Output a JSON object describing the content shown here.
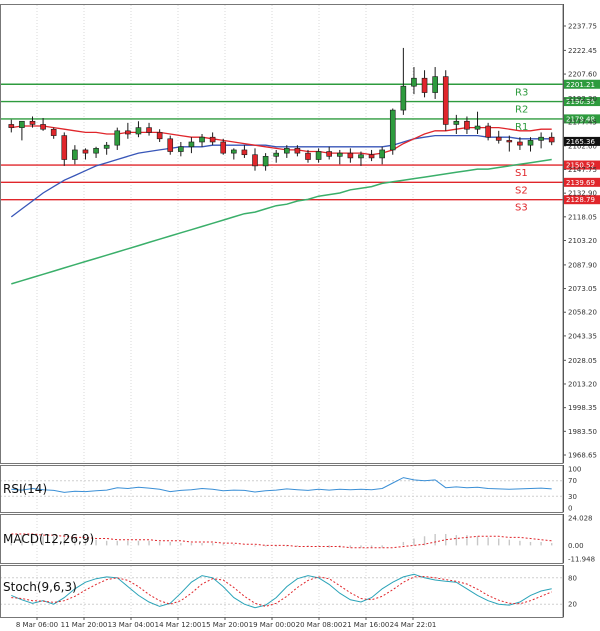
{
  "chart_data": [
    {
      "type": "candlestick",
      "panel": "price",
      "y_ticks": [
        "2237.75",
        "2222.45",
        "2207.60",
        "2192.30",
        "2177.45",
        "2162.60",
        "2147.75",
        "2132.90",
        "2118.05",
        "2103.20",
        "2087.90",
        "2073.05",
        "2058.20",
        "2043.35",
        "2028.05",
        "2013.20",
        "1998.35",
        "1983.50",
        "1968.65"
      ],
      "ylim": [
        1968.65,
        2237.75
      ],
      "x_labels": [
        "8 Mar 06:00",
        "11 Mar 20:00",
        "13 Mar 04:00",
        "14 Mar 12:00",
        "15 Mar 20:00",
        "19 Mar 00:00",
        "20 Mar 08:00",
        "21 Mar 16:00",
        "24 Mar 22:01"
      ],
      "current_price": "2165.36",
      "current_price_value": 2165.36,
      "levels": [
        {
          "label": "R3",
          "value": 2201.21,
          "display": "2201.21",
          "color": "#2e9b3e"
        },
        {
          "label": "R2",
          "value": 2190.35,
          "display": "2190.35",
          "color": "#2e9b3e"
        },
        {
          "label": "R1",
          "value": 2179.48,
          "display": "2179.48",
          "color": "#2e9b3e"
        },
        {
          "label": "S1",
          "value": 2150.52,
          "display": "2150.52",
          "color": "#e0262b"
        },
        {
          "label": "S2",
          "value": 2139.69,
          "display": "2139.69",
          "color": "#e0262b"
        },
        {
          "label": "S3",
          "value": 2128.79,
          "display": "2128.79",
          "color": "#e0262b"
        }
      ],
      "candles": [
        [
          2176,
          2179,
          2171,
          2174
        ],
        [
          2174,
          2176,
          2166,
          2178
        ],
        [
          2178,
          2181,
          2174,
          2176
        ],
        [
          2176,
          2180,
          2172,
          2173
        ],
        [
          2173,
          2174,
          2167,
          2169
        ],
        [
          2169,
          2171,
          2150,
          2154
        ],
        [
          2154,
          2163,
          2151,
          2160
        ],
        [
          2160,
          2161,
          2154,
          2158
        ],
        [
          2158,
          2162,
          2155,
          2161
        ],
        [
          2161,
          2165,
          2157,
          2163
        ],
        [
          2163,
          2174,
          2160,
          2172
        ],
        [
          2172,
          2177,
          2167,
          2170
        ],
        [
          2170,
          2178,
          2168,
          2174
        ],
        [
          2174,
          2177,
          2169,
          2171
        ],
        [
          2171,
          2173,
          2165,
          2167
        ],
        [
          2167,
          2169,
          2157,
          2159
        ],
        [
          2159,
          2165,
          2156,
          2162
        ],
        [
          2162,
          2168,
          2158,
          2165
        ],
        [
          2165,
          2170,
          2162,
          2168
        ],
        [
          2168,
          2171,
          2163,
          2165
        ],
        [
          2165,
          2167,
          2157,
          2158
        ],
        [
          2158,
          2161,
          2154,
          2160
        ],
        [
          2160,
          2163,
          2155,
          2157
        ],
        [
          2157,
          2161,
          2147,
          2150
        ],
        [
          2150,
          2158,
          2147,
          2156
        ],
        [
          2156,
          2160,
          2152,
          2158
        ],
        [
          2158,
          2163,
          2155,
          2161
        ],
        [
          2161,
          2163,
          2156,
          2158
        ],
        [
          2158,
          2160,
          2152,
          2154
        ],
        [
          2154,
          2161,
          2152,
          2159
        ],
        [
          2159,
          2162,
          2154,
          2156
        ],
        [
          2156,
          2160,
          2151,
          2158
        ],
        [
          2158,
          2161,
          2152,
          2155
        ],
        [
          2155,
          2159,
          2150,
          2157
        ],
        [
          2157,
          2160,
          2153,
          2155
        ],
        [
          2155,
          2162,
          2151,
          2160
        ],
        [
          2160,
          2186,
          2157,
          2185
        ],
        [
          2185,
          2224,
          2182,
          2200
        ],
        [
          2200,
          2212,
          2195,
          2205
        ],
        [
          2205,
          2210,
          2193,
          2196
        ],
        [
          2196,
          2212,
          2192,
          2206
        ],
        [
          2206,
          2210,
          2172,
          2176
        ],
        [
          2176,
          2182,
          2170,
          2178
        ],
        [
          2178,
          2181,
          2170,
          2173
        ],
        [
          2173,
          2184,
          2170,
          2175
        ],
        [
          2175,
          2177,
          2166,
          2168
        ],
        [
          2168,
          2172,
          2164,
          2166
        ],
        [
          2166,
          2169,
          2159,
          2165
        ],
        [
          2165,
          2168,
          2160,
          2163
        ],
        [
          2163,
          2168,
          2159,
          2166
        ],
        [
          2166,
          2171,
          2161,
          2168
        ],
        [
          2168,
          2171,
          2163,
          2165
        ]
      ],
      "ma_fast": [
        2174,
        2175,
        2175,
        2175,
        2174,
        2173,
        2172,
        2171,
        2171,
        2170,
        2170,
        2171,
        2171,
        2171,
        2171,
        2170,
        2169,
        2168,
        2168,
        2167,
        2166,
        2165,
        2164,
        2163,
        2162,
        2161,
        2160,
        2160,
        2159,
        2159,
        2158,
        2158,
        2158,
        2158,
        2157,
        2158,
        2160,
        2164,
        2167,
        2170,
        2172,
        2172,
        2173,
        2174,
        2174,
        2174,
        2174,
        2173,
        2172,
        2172,
        2173,
        2173
      ],
      "ma_mid": [
        2118,
        2123,
        2128,
        2133,
        2137,
        2141,
        2144,
        2147,
        2150,
        2152,
        2154,
        2156,
        2158,
        2159,
        2160,
        2161,
        2162,
        2162,
        2162,
        2163,
        2163,
        2163,
        2163,
        2163,
        2163,
        2162,
        2162,
        2162,
        2162,
        2162,
        2162,
        2162,
        2162,
        2162,
        2162,
        2162,
        2163,
        2165,
        2167,
        2168,
        2169,
        2169,
        2169,
        2169,
        2169,
        2168,
        2168,
        2168,
        2167,
        2167,
        2167,
        2167
      ],
      "ma_slow": [
        2076,
        2078,
        2080,
        2082,
        2084,
        2086,
        2088,
        2090,
        2092,
        2094,
        2096,
        2098,
        2100,
        2102,
        2104,
        2106,
        2108,
        2110,
        2112,
        2114,
        2116,
        2118,
        2120,
        2121,
        2123,
        2125,
        2126,
        2128,
        2129,
        2131,
        2132,
        2133,
        2135,
        2136,
        2137,
        2139,
        2140,
        2141,
        2142,
        2143,
        2144,
        2145,
        2146,
        2147,
        2148,
        2148,
        2149,
        2150,
        2151,
        2152,
        2153,
        2154
      ]
    },
    {
      "type": "line",
      "panel": "rsi",
      "title": "RSI(14)",
      "y_ticks": [
        "100",
        "70",
        "30",
        "0"
      ],
      "ylim": [
        0,
        100
      ],
      "values": [
        48,
        46,
        50,
        47,
        45,
        40,
        43,
        42,
        44,
        46,
        52,
        50,
        53,
        51,
        48,
        42,
        45,
        47,
        50,
        48,
        44,
        46,
        45,
        41,
        44,
        46,
        49,
        47,
        45,
        48,
        46,
        48,
        47,
        48,
        47,
        50,
        64,
        78,
        72,
        70,
        72,
        52,
        54,
        52,
        53,
        50,
        49,
        48,
        49,
        50,
        51,
        49
      ]
    },
    {
      "type": "bar",
      "panel": "macd",
      "title": "MACD(12,26,9)",
      "y_ticks": [
        "24.028",
        "0.00",
        "-11.948"
      ],
      "ylim": [
        -11.948,
        24.028
      ],
      "values": [
        9,
        9,
        9,
        8,
        8,
        7,
        6,
        5,
        5,
        4,
        4,
        4,
        4,
        4,
        3,
        3,
        2,
        2,
        2,
        2,
        1,
        1,
        0,
        -1,
        -1,
        -1,
        -1,
        -1,
        -1,
        -1,
        -2,
        -2,
        -2,
        -2,
        -2,
        -2,
        0,
        3,
        6,
        8,
        10,
        10,
        9,
        9,
        8,
        7,
        6,
        5,
        4,
        3,
        3,
        2
      ],
      "signal": [
        10,
        10,
        10,
        9,
        9,
        8,
        7,
        7,
        6,
        6,
        5,
        5,
        5,
        5,
        4,
        4,
        4,
        3,
        3,
        3,
        2,
        2,
        1,
        1,
        0,
        0,
        0,
        -1,
        -1,
        -1,
        -1,
        -1,
        -2,
        -2,
        -2,
        -2,
        -2,
        -1,
        0,
        1,
        3,
        5,
        6,
        7,
        8,
        8,
        8,
        7,
        7,
        6,
        5,
        4
      ]
    },
    {
      "type": "line",
      "panel": "stoch",
      "title": "Stoch(9,6,3)",
      "y_ticks": [
        "80",
        "20"
      ],
      "ylim": [
        0,
        100
      ],
      "k": [
        40,
        30,
        22,
        28,
        20,
        35,
        55,
        70,
        78,
        82,
        80,
        60,
        40,
        25,
        15,
        22,
        45,
        70,
        85,
        80,
        60,
        35,
        20,
        12,
        18,
        35,
        60,
        78,
        85,
        80,
        65,
        45,
        30,
        25,
        35,
        55,
        70,
        82,
        88,
        80,
        75,
        72,
        70,
        55,
        40,
        28,
        20,
        18,
        25,
        40,
        50,
        55
      ],
      "d": [
        35,
        33,
        28,
        27,
        24,
        28,
        38,
        52,
        65,
        76,
        80,
        74,
        60,
        42,
        28,
        20,
        28,
        45,
        66,
        78,
        75,
        58,
        38,
        22,
        15,
        22,
        38,
        58,
        74,
        82,
        78,
        62,
        46,
        33,
        30,
        38,
        53,
        70,
        82,
        83,
        80,
        76,
        72,
        66,
        54,
        40,
        29,
        22,
        21,
        28,
        38,
        48
      ]
    }
  ],
  "colors": {
    "bull": "#2e9b3e",
    "bear": "#e0262b",
    "ma_fast": "#e0262b",
    "ma_mid": "#3856b8",
    "ma_slow": "#3aaf6a",
    "rsi": "#3a8fd6",
    "macd_hist": "#c7c7c7",
    "macd_signal": "#e0262b",
    "stoch_k": "#2aa3b8",
    "stoch_d": "#e0262b",
    "price_badge": "#111111"
  }
}
